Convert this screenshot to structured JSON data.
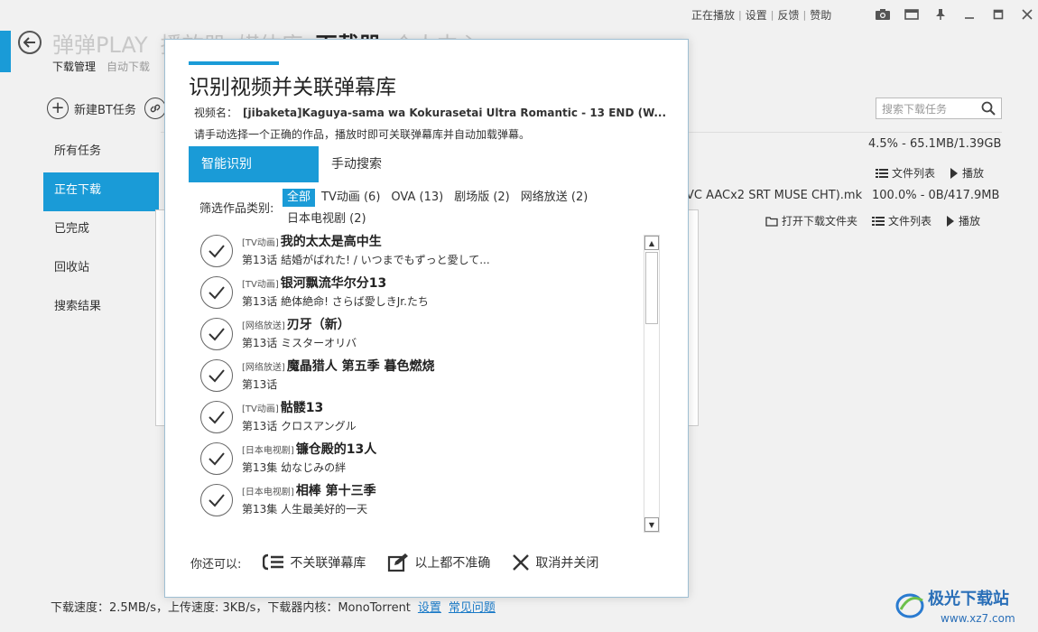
{
  "topbar": {
    "links": [
      "正在播放",
      "设置",
      "反馈",
      "赞助"
    ],
    "icons": [
      "camera-icon",
      "screen-icon",
      "pin-icon",
      "minimize-icon",
      "maximize-icon",
      "close-icon"
    ]
  },
  "header": {
    "nav": [
      "弹弹PLAY",
      "播放器",
      "媒体库",
      "下载器",
      "个人中心"
    ],
    "active_nav": "下载器",
    "subtabs": [
      "下载管理",
      "自动下载"
    ]
  },
  "toolbar": {
    "new_bt": "新建BT任务"
  },
  "sidebar": {
    "items": [
      {
        "label": "所有任务"
      },
      {
        "label": "正在下载"
      },
      {
        "label": "已完成"
      },
      {
        "label": "回收站"
      },
      {
        "label": "搜索结果"
      }
    ],
    "active_index": 1
  },
  "search": {
    "placeholder": "搜索下载任务"
  },
  "tasks": [
    {
      "name": "",
      "status": "4.5% - 65.1MB/1.39GB",
      "actions": [
        "文件列表",
        "播放"
      ]
    },
    {
      "name": "VC AACx2 SRT MUSE CHT).mk",
      "status": "100.0% - 0B/417.9MB",
      "actions": [
        "打开下载文件夹",
        "文件列表",
        "播放"
      ]
    }
  ],
  "footer": {
    "text": "下载速度：2.5MB/s，上传速度: 3KB/s，下载器内核：MonoTorrent",
    "links": [
      "设置",
      "常见问题"
    ]
  },
  "watermark": {
    "text": "极光下载站",
    "url": "www.xz7.com"
  },
  "dialog": {
    "title": "识别视频并关联弹幕库",
    "filename_label": "视频名：",
    "filename": "[jibaketa]Kaguya-sama wa Kokurasetai Ultra Romantic - 13 END (W...",
    "hint": "请手动选择一个正确的作品，播放时即可关联弹幕库并自动加载弹幕。",
    "tabs": [
      "智能识别",
      "手动搜索"
    ],
    "filter_label": "筛选作品类别:",
    "filters": [
      "全部",
      "TV动画 (6)",
      "OVA (13)",
      "剧场版 (2)",
      "网络放送 (2)",
      "日本电视剧 (2)"
    ],
    "results": [
      {
        "tag": "[TV动画]",
        "title": "我的太太是高中生",
        "episode": "第13话 結婚がばれた! / いつまでもずっと愛して..."
      },
      {
        "tag": "[TV动画]",
        "title": "银河飘流华尔分13",
        "episode": "第13话 絶体絶命! さらば愛しきJr.たち"
      },
      {
        "tag": "[网络放送]",
        "title": "刃牙（新）",
        "episode": "第13话 ミスターオリバ"
      },
      {
        "tag": "[网络放送]",
        "title": "魔晶猎人 第五季 暮色燃烧",
        "episode": "第13话"
      },
      {
        "tag": "[TV动画]",
        "title": "骷髅13",
        "episode": "第13话 クロスアングル"
      },
      {
        "tag": "[日本电视剧]",
        "title": "镰仓殿的13人",
        "episode": "第13集 幼なじみの絆"
      },
      {
        "tag": "[日本电视剧]",
        "title": "相棒 第十三季",
        "episode": "第13集 人生最美好的一天"
      }
    ],
    "footer_label": "你还可以:",
    "actions": [
      "不关联弹幕库",
      "以上都不准确",
      "取消并关闭"
    ]
  }
}
